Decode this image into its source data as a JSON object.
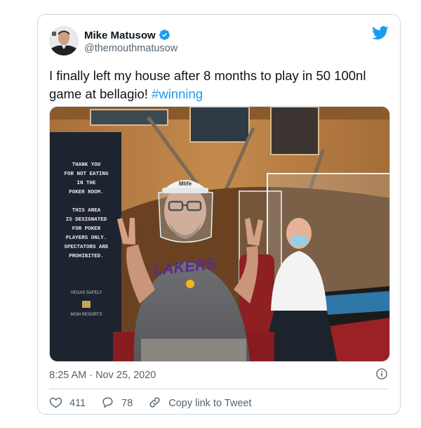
{
  "tweet": {
    "author_name": "Mike Matusow",
    "author_handle": "@themouthmatusow",
    "text_main": "I finally left my house after 8 months to play in 50 100nl game at bellagio! ",
    "hashtag": "#winning",
    "timestamp": "8:25 AM · Nov 25, 2020",
    "like_count": "411",
    "reply_count": "78",
    "copy_link_label": "Copy link to Tweet"
  },
  "photo": {
    "sign_text": [
      "THANK YOU",
      "FOR NOT EATING",
      "IN THE",
      "POKER ROOM.",
      "",
      "THIS AREA",
      "IS DESIGNATED",
      "FOR POKER",
      "PLAYERS ONLY.",
      "SPECTATORS ARE",
      "PROHIBITED."
    ],
    "sign_footer": "VEGAS SAFELY",
    "sign_brand": "MGM RESORTS",
    "shirt_text": "LAKERS",
    "hat_text": "Mlife"
  },
  "colors": {
    "accent": "#1d9bf0",
    "text_primary": "#0f1419",
    "text_secondary": "#536471",
    "border": "#cfd9de"
  },
  "icons": [
    "verified-badge-icon",
    "twitter-bird-icon",
    "info-icon",
    "heart-icon",
    "reply-bubble-icon",
    "link-icon"
  ]
}
